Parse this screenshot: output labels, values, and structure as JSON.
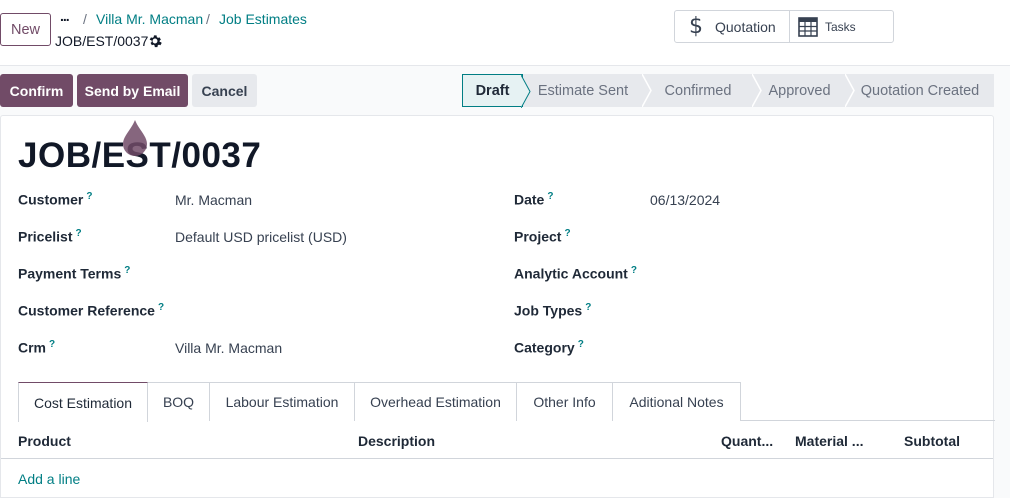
{
  "header": {
    "new_button": "New",
    "breadcrumb_more": "...",
    "breadcrumb": [
      "Villa Mr. Macman",
      "Job Estimates"
    ],
    "breadcrumb_separator": "/",
    "record_name": "JOB/EST/0037",
    "settings_icon": "gear-icon"
  },
  "smart_buttons": {
    "quotation": {
      "icon": "dollar-icon",
      "label": "Quotation"
    },
    "tasks": {
      "icon": "calendar-grid-icon",
      "label": "Tasks"
    }
  },
  "actions": {
    "confirm": "Confirm",
    "send_by_email": "Send by Email",
    "cancel": "Cancel"
  },
  "statusbar": {
    "stages": [
      "Draft",
      "Estimate Sent",
      "Confirmed",
      "Approved",
      "Quotation Created"
    ],
    "active": "Draft"
  },
  "form": {
    "title": "JOB/EST/0037",
    "help_marker": "?",
    "left_fields": [
      {
        "label": "Customer",
        "value": "Mr. Macman"
      },
      {
        "label": "Pricelist",
        "value": "Default USD pricelist (USD)"
      },
      {
        "label": "Payment Terms",
        "value": ""
      },
      {
        "label": "Customer Reference",
        "value": ""
      },
      {
        "label": "Crm",
        "value": "Villa Mr. Macman"
      }
    ],
    "right_fields": [
      {
        "label": "Date",
        "value": "06/13/2024"
      },
      {
        "label": "Project",
        "value": ""
      },
      {
        "label": "Analytic Account",
        "value": ""
      },
      {
        "label": "Job Types",
        "value": ""
      },
      {
        "label": "Category",
        "value": ""
      }
    ]
  },
  "tabs": [
    "Cost Estimation",
    "BOQ",
    "Labour Estimation",
    "Overhead Estimation",
    "Other Info",
    "Aditional Notes"
  ],
  "active_tab": "Cost Estimation",
  "table": {
    "columns": [
      "Product",
      "Description",
      "Quant...",
      "Material ...",
      "Subtotal"
    ],
    "add_line": "Add a line"
  },
  "colors": {
    "primary": "#714b67",
    "link": "#017e84",
    "secondary_button": "#e7e9ed"
  }
}
